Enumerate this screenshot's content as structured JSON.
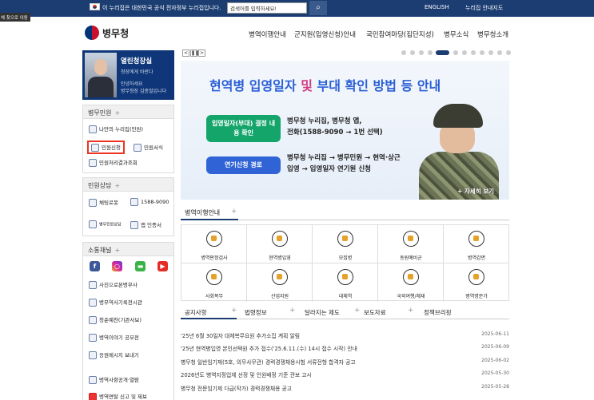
{
  "topbar": {
    "notice": "이 누리집은 대한민국 공식 전자정부 누리집입니다.",
    "search_placeholder": "검색어를 입력하세요!",
    "english": "ENGLISH",
    "site_guide": "누리집 안내지도",
    "skip": "본문 바로가기",
    "skip_text": "체 찾으로 이동"
  },
  "header": {
    "logo": "병무청",
    "nav": [
      "병역이행안내",
      "군지원(입영신청)안내",
      "국민참여마당(집단지성)",
      "병무소식",
      "병무청소개"
    ]
  },
  "sidebar": {
    "chief": {
      "title": "열린청장실",
      "lines": [
        "청장에게 바란다",
        "안녕하세요",
        "병무청장 김종철입니다"
      ]
    },
    "civil": {
      "title": "병무민원",
      "items": [
        "나만의 누리집(민원)",
        "민원신청",
        "민원서식",
        "민원처리결과조회"
      ]
    },
    "consult": {
      "title": "민원상담",
      "items": [
        "채팅로봇",
        "1588-9090",
        "병무민원상담",
        "앱 인증서"
      ]
    },
    "social": {
      "title": "소통채널",
      "icons": [
        "facebook-icon",
        "instagram-icon",
        "talk-icon",
        "youtube-icon"
      ],
      "items": [
        "사진으로본병무사",
        "병무역사기록전시관",
        "청춘예찬(기관사보)",
        "병역이야기 공모전",
        "응원메시지 보내기",
        "병역사항공개·열람",
        "병역면탈 신고 및 제보"
      ]
    }
  },
  "banner": {
    "title_a": "현역병 입영일자 ",
    "title_b": "및",
    "title_c": " 부대 확인 방법 등 안내",
    "pill1": "입영일자(부대) 결정 내용 확인",
    "text1a": "병무청 누리집, 병무청 앱,",
    "text1b": "전화(1588-9090 → 1번 선택)",
    "pill2": "연기신청 경로",
    "text2a": "병무청 누리집 → 병무민원 → 현역·상근",
    "text2b": "입영 → 입영일자 연기원 신청",
    "more": "+ 자세히 보기"
  },
  "duty": {
    "title": "병역이행안내",
    "items": [
      "병역판정검사",
      "현역병입영",
      "모집병",
      "동원예비군",
      "병역감면",
      "사회복무",
      "산업지원",
      "대체역",
      "국외여행/체재",
      "병역명문가"
    ]
  },
  "tabs": [
    "공지사항",
    "법령정보",
    "달라지는 제도",
    "보도자료",
    "정책브리핑"
  ],
  "news": [
    {
      "title": "'25년 6월 30일자 대체복무요원 추가소집 계획 알림",
      "date": "2025-06-11"
    },
    {
      "title": "'25년 현역병입영 본인선택원 추가 접수('25.6.11.(수) 14시 접수 시작) 안내",
      "date": "2025-06-09"
    },
    {
      "title": "병무청 일반임기제(5호, 의무사무관) 경력경쟁채용시험 서류전형 합격자 공고",
      "date": "2025-06-02"
    },
    {
      "title": "2026년도 병역지정업체 선정 및 인원배정 기준 관보 고시",
      "date": "2025-05-30"
    },
    {
      "title": "병무청 전문임기제 다급(작가) 경력경쟁채용 공고",
      "date": "2025-05-28"
    }
  ]
}
